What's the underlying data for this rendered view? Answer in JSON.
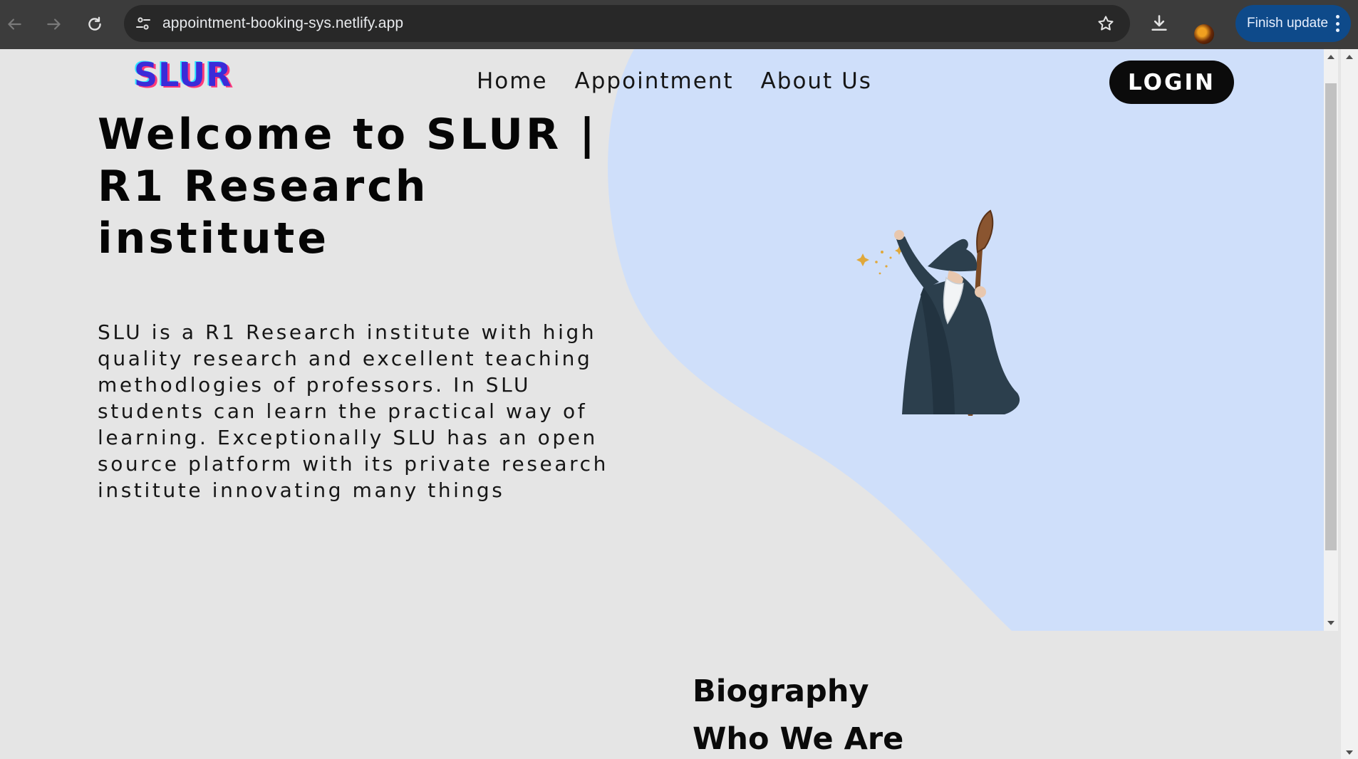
{
  "browser": {
    "url": "appointment-booking-sys.netlify.app",
    "update_button_label": "Finish update",
    "icons": {
      "back": "arrow-left-icon",
      "forward": "arrow-right-icon",
      "reload": "reload-icon",
      "site_info": "tune-icon",
      "bookmark": "star-icon",
      "download": "download-icon",
      "menu": "kebab-menu-icon"
    }
  },
  "site": {
    "logo": "SLUR",
    "nav": [
      {
        "label": "Home"
      },
      {
        "label": "Appointment"
      },
      {
        "label": "About Us"
      }
    ],
    "login_label": "LOGIN",
    "hero": {
      "title": "Welcome to SLUR | R1 Research institute",
      "description": "SLU is a R1 Research institute with high quality research and excellent teaching methodlogies of professors. In SLU students can learn the practical way of learning. Exceptionally SLU has an open source platform with its private research institute innovating many things"
    },
    "section": {
      "title": "Biography",
      "subtitle": "Who We Are"
    },
    "colors": {
      "page_bg": "#e5e5e5",
      "blob": "#cfdffa",
      "login_bg": "#0b0b0b",
      "logo": "#3b2bd8"
    }
  }
}
